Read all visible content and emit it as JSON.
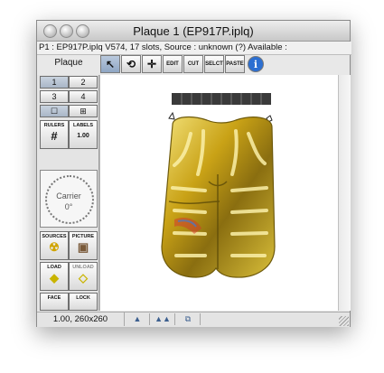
{
  "window": {
    "title": "Plaque 1 (EP917P.iplq)"
  },
  "info_line": "P1 : EP917P.iplq V574, 17 slots, Source : unknown (?) Available :",
  "sidebar": {
    "header": "Plaque",
    "slots": [
      "1",
      "2",
      "3",
      "4"
    ],
    "view_buttons": [
      {
        "icon": "square-view-icon",
        "glyph": "☐"
      },
      {
        "icon": "grid-view-icon",
        "glyph": "⊞"
      }
    ],
    "tools": [
      {
        "label": "RULERS",
        "icon": "rulers-grid-icon",
        "glyph": "#"
      },
      {
        "label": "LABELS",
        "icon": "labels-icon",
        "glyph": "1.00"
      },
      {
        "label": "SOURCES",
        "icon": "radiation-icon",
        "glyph": "☢"
      },
      {
        "label": "PICTURE",
        "icon": "picture-icon",
        "glyph": "▣"
      },
      {
        "label": "LOAD",
        "icon": "load-icon",
        "glyph": "◆"
      },
      {
        "label": "UNLOAD",
        "icon": "unload-icon",
        "glyph": "◇"
      },
      {
        "label": "FACE",
        "icon": "face-icon",
        "glyph": "☻"
      },
      {
        "label": "LOCK",
        "icon": "lock-icon",
        "glyph": "☻"
      }
    ],
    "dial": {
      "label": "Carrier",
      "angle": "0°"
    }
  },
  "toolbar": [
    {
      "label": "",
      "icon": "select-arrow-icon",
      "glyph": "↖"
    },
    {
      "label": "",
      "icon": "rotate-icon",
      "glyph": "⟲"
    },
    {
      "label": "",
      "icon": "crosshair-icon",
      "glyph": "✛"
    },
    {
      "label": "EDIT",
      "icon": "edit-icon",
      "glyph": ""
    },
    {
      "label": "CUT",
      "icon": "cut-icon",
      "glyph": ""
    },
    {
      "label": "SELCT",
      "icon": "select-icon",
      "glyph": ""
    },
    {
      "label": "PASTE",
      "icon": "paste-icon",
      "glyph": ""
    },
    {
      "label": "i",
      "icon": "info-icon",
      "glyph": ""
    }
  ],
  "status": {
    "zoom": "1.00, 260x260",
    "buttons": [
      {
        "icon": "zoom-out-mountain-icon",
        "glyph": "▲"
      },
      {
        "icon": "zoom-in-mountain-icon",
        "glyph": "▲▲"
      },
      {
        "icon": "copy-view-icon",
        "glyph": "⧉"
      }
    ]
  },
  "colors": {
    "gold": "#c9a216",
    "gold_light": "#f2e07a",
    "gold_dark": "#6e5a0c",
    "scale_bar": "#3a3a3a",
    "accent_blue": "#2c6fd1"
  }
}
